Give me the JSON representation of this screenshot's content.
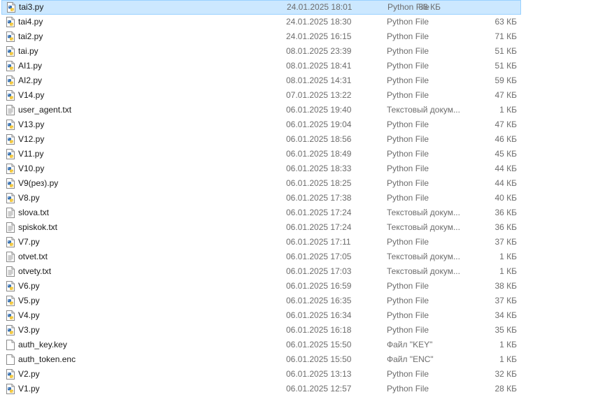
{
  "files": [
    {
      "name": "tai3.py",
      "date": "24.01.2025 18:01",
      "type": "Python File",
      "size": "86 КБ",
      "icon": "python-file-icon",
      "selected": true
    },
    {
      "name": "tai4.py",
      "date": "24.01.2025 18:30",
      "type": "Python File",
      "size": "63 КБ",
      "icon": "python-file-icon"
    },
    {
      "name": "tai2.py",
      "date": "24.01.2025 16:15",
      "type": "Python File",
      "size": "71 КБ",
      "icon": "python-file-icon"
    },
    {
      "name": "tai.py",
      "date": "08.01.2025 23:39",
      "type": "Python File",
      "size": "51 КБ",
      "icon": "python-file-icon"
    },
    {
      "name": "AI1.py",
      "date": "08.01.2025 18:41",
      "type": "Python File",
      "size": "51 КБ",
      "icon": "python-file-icon"
    },
    {
      "name": "AI2.py",
      "date": "08.01.2025 14:31",
      "type": "Python File",
      "size": "59 КБ",
      "icon": "python-file-icon"
    },
    {
      "name": "V14.py",
      "date": "07.01.2025 13:22",
      "type": "Python File",
      "size": "47 КБ",
      "icon": "python-file-icon"
    },
    {
      "name": "user_agent.txt",
      "date": "06.01.2025 19:40",
      "type": "Текстовый докум...",
      "size": "1 КБ",
      "icon": "text-file-icon"
    },
    {
      "name": "V13.py",
      "date": "06.01.2025 19:04",
      "type": "Python File",
      "size": "47 КБ",
      "icon": "python-file-icon"
    },
    {
      "name": "V12.py",
      "date": "06.01.2025 18:56",
      "type": "Python File",
      "size": "46 КБ",
      "icon": "python-file-icon"
    },
    {
      "name": "V11.py",
      "date": "06.01.2025 18:49",
      "type": "Python File",
      "size": "45 КБ",
      "icon": "python-file-icon"
    },
    {
      "name": "V10.py",
      "date": "06.01.2025 18:33",
      "type": "Python File",
      "size": "44 КБ",
      "icon": "python-file-icon"
    },
    {
      "name": "V9(рез).py",
      "date": "06.01.2025 18:25",
      "type": "Python File",
      "size": "44 КБ",
      "icon": "python-file-icon"
    },
    {
      "name": "V8.py",
      "date": "06.01.2025 17:38",
      "type": "Python File",
      "size": "40 КБ",
      "icon": "python-file-icon"
    },
    {
      "name": "slova.txt",
      "date": "06.01.2025 17:24",
      "type": "Текстовый докум...",
      "size": "36 КБ",
      "icon": "text-file-icon"
    },
    {
      "name": "spiskok.txt",
      "date": "06.01.2025 17:24",
      "type": "Текстовый докум...",
      "size": "36 КБ",
      "icon": "text-file-icon"
    },
    {
      "name": "V7.py",
      "date": "06.01.2025 17:11",
      "type": "Python File",
      "size": "37 КБ",
      "icon": "python-file-icon"
    },
    {
      "name": "otvet.txt",
      "date": "06.01.2025 17:05",
      "type": "Текстовый докум...",
      "size": "1 КБ",
      "icon": "text-file-icon"
    },
    {
      "name": "otvety.txt",
      "date": "06.01.2025 17:03",
      "type": "Текстовый докум...",
      "size": "1 КБ",
      "icon": "text-file-icon"
    },
    {
      "name": "V6.py",
      "date": "06.01.2025 16:59",
      "type": "Python File",
      "size": "38 КБ",
      "icon": "python-file-icon"
    },
    {
      "name": "V5.py",
      "date": "06.01.2025 16:35",
      "type": "Python File",
      "size": "37 КБ",
      "icon": "python-file-icon"
    },
    {
      "name": "V4.py",
      "date": "06.01.2025 16:34",
      "type": "Python File",
      "size": "34 КБ",
      "icon": "python-file-icon"
    },
    {
      "name": "V3.py",
      "date": "06.01.2025 16:18",
      "type": "Python File",
      "size": "35 КБ",
      "icon": "python-file-icon"
    },
    {
      "name": "auth_key.key",
      "date": "06.01.2025 15:50",
      "type": "Файл \"KEY\"",
      "size": "1 КБ",
      "icon": "blank-file-icon"
    },
    {
      "name": "auth_token.enc",
      "date": "06.01.2025 15:50",
      "type": "Файл \"ENC\"",
      "size": "1 КБ",
      "icon": "blank-file-icon"
    },
    {
      "name": "V2.py",
      "date": "06.01.2025 13:13",
      "type": "Python File",
      "size": "32 КБ",
      "icon": "python-file-icon"
    },
    {
      "name": "V1.py",
      "date": "06.01.2025 12:57",
      "type": "Python File",
      "size": "28 КБ",
      "icon": "python-file-icon"
    }
  ],
  "colors": {
    "selection_bg": "#cce8ff",
    "selection_border": "#99d1ff",
    "secondary_text": "#6d6d6d",
    "python_blue": "#3a73b5",
    "python_yellow": "#f2c73d"
  }
}
